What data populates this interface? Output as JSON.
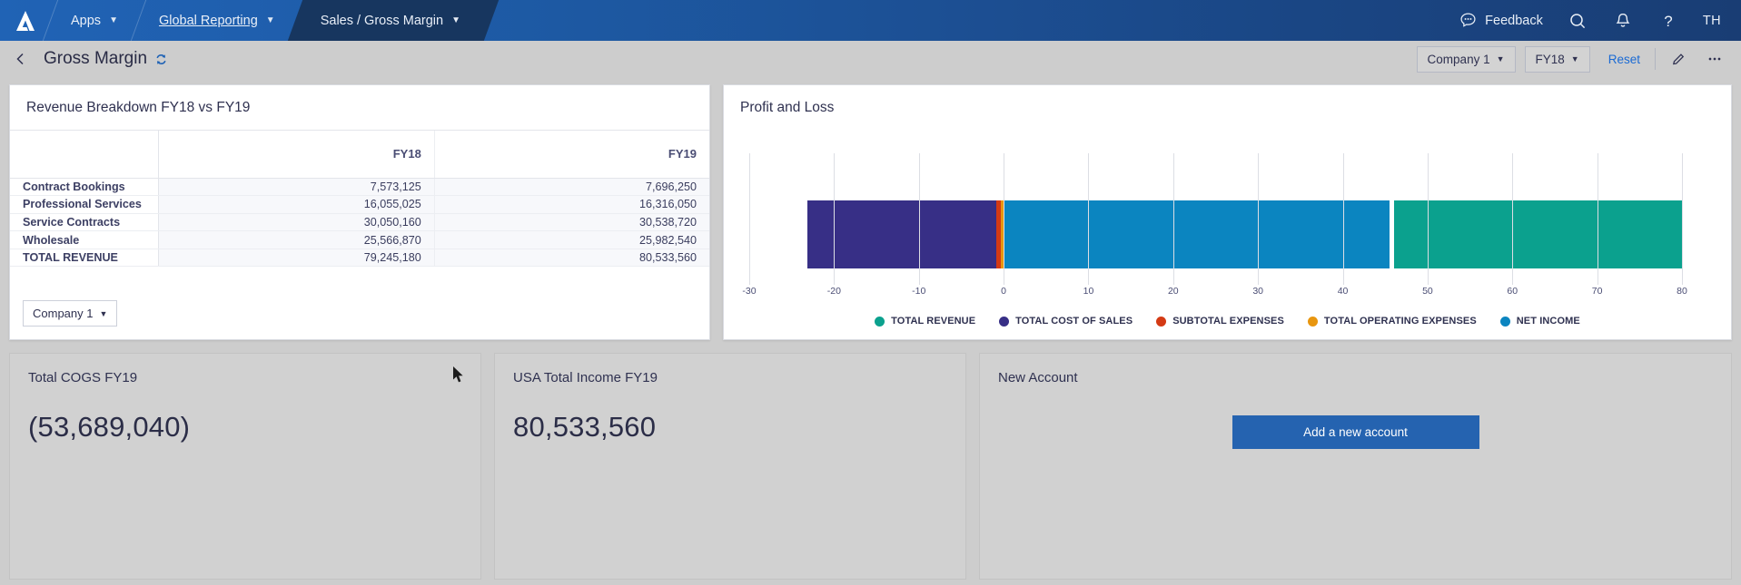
{
  "topnav": {
    "logo": "logo-a-mark",
    "apps_label": "Apps",
    "workspace_label": "Global Reporting",
    "page_crumb": "Sales / Gross Margin",
    "feedback_label": "Feedback",
    "search_icon": "search-icon",
    "bell_icon": "bell-icon",
    "help_icon": "question-mark-icon",
    "avatar_initials": "TH",
    "bg_color": "#1d59a3"
  },
  "toolbar": {
    "back_icon": "chevron-left-icon",
    "title": "Gross Margin",
    "sync_icon": "sync-icon",
    "company_filter": "Company 1",
    "year_filter": "FY18",
    "reset_label": "Reset",
    "edit_icon": "pencil-icon",
    "more_icon": "ellipsis-icon",
    "link_color": "#1a6ad4"
  },
  "revenue_panel": {
    "title": "Revenue Breakdown FY18 vs FY19",
    "columns": [
      "",
      "FY18",
      "FY19"
    ],
    "rows": [
      {
        "label": "Contract Bookings",
        "fy18": "7,573,125",
        "fy19": "7,696,250"
      },
      {
        "label": "Professional Services",
        "fy18": "16,055,025",
        "fy19": "16,316,050"
      },
      {
        "label": "Service Contracts",
        "fy18": "30,050,160",
        "fy19": "30,538,720"
      },
      {
        "label": "Wholesale",
        "fy18": "25,566,870",
        "fy19": "25,982,540"
      },
      {
        "label": "TOTAL REVENUE",
        "fy18": "79,245,180",
        "fy19": "80,533,560"
      }
    ],
    "company_selector": "Company 1"
  },
  "chart_panel": {
    "title": "Profit and Loss"
  },
  "chart_data": {
    "type": "bar",
    "orientation": "horizontal",
    "title": "Profit and Loss",
    "xlabel": "",
    "ylabel": "",
    "xlim": [
      -30,
      80
    ],
    "xticks": [
      "-30",
      "-20",
      "-10",
      "0",
      "10",
      "20",
      "30",
      "40",
      "50",
      "60",
      "70",
      "80"
    ],
    "grid": true,
    "legend_position": "bottom",
    "stacked": true,
    "series": [
      {
        "name": "TOTAL COST OF SALES",
        "color": "#372f86",
        "start": -23.1,
        "end": -0.9,
        "value": 22.2
      },
      {
        "name": "SUBTOTAL EXPENSES",
        "color": "#d43a14",
        "start": -0.9,
        "end": -0.35,
        "value": 0.55
      },
      {
        "name": "TOTAL OPERATING EXPENSES",
        "color": "#e8960f",
        "start": -0.35,
        "end": 0.0,
        "value": 0.35
      },
      {
        "name": "NET INCOME",
        "color": "#0b85c0",
        "start": 0.0,
        "end": 45.5,
        "value": 45.5
      },
      {
        "name": "TOTAL REVENUE",
        "color": "#0ba18e",
        "start": 46.0,
        "end": 80.0,
        "value": 34.0
      }
    ],
    "legend": [
      {
        "label": "TOTAL REVENUE",
        "color": "#0ba18e"
      },
      {
        "label": "TOTAL COST OF SALES",
        "color": "#372f86"
      },
      {
        "label": "SUBTOTAL EXPENSES",
        "color": "#d43a14"
      },
      {
        "label": "TOTAL OPERATING EXPENSES",
        "color": "#e8960f"
      },
      {
        "label": "NET INCOME",
        "color": "#0b85c0"
      }
    ]
  },
  "kpis": [
    {
      "title": "Total COGS FY19",
      "value": "(53,689,040)"
    },
    {
      "title": "USA Total Income FY19",
      "value": "80,533,560"
    }
  ],
  "new_account": {
    "title": "New Account",
    "button_label": "Add a new account",
    "button_color": "#2563b0"
  }
}
